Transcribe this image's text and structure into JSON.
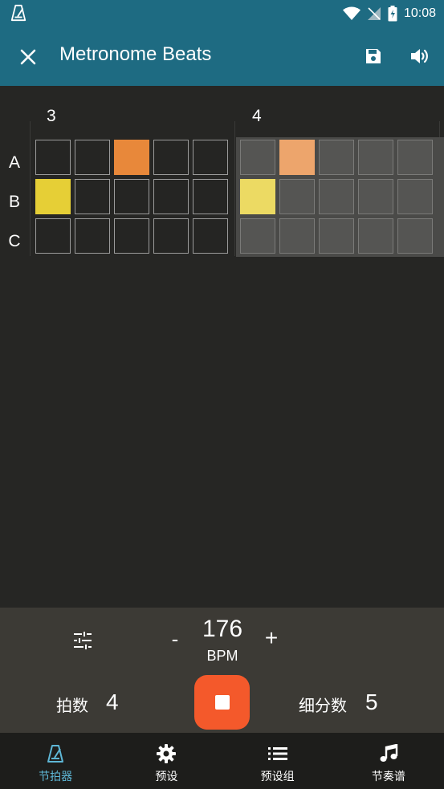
{
  "status_bar": {
    "time": "10:08"
  },
  "app_bar": {
    "title": "Metronome Beats"
  },
  "grid": {
    "bars": [
      {
        "number": "3",
        "active": true
      },
      {
        "number": "4",
        "active": false
      }
    ],
    "rows": [
      "A",
      "B",
      "C"
    ],
    "colors": {
      "orange": "#e8883a",
      "yellow": "#e6cf36",
      "grid_border": "#9a9a9a"
    }
  },
  "controls": {
    "bpm_value": "176",
    "bpm_label": "BPM",
    "minus_label": "-",
    "plus_label": "+",
    "beats_label": "拍数",
    "beats_value": "4",
    "subdivision_label": "细分数",
    "subdivision_value": "5",
    "stop_color": "#f4592b"
  },
  "bottom_nav": {
    "items": [
      {
        "label": "节拍器",
        "icon": "metronome-icon",
        "active": true
      },
      {
        "label": "预设",
        "icon": "gear-icon",
        "active": false
      },
      {
        "label": "预设组",
        "icon": "list-icon",
        "active": false
      },
      {
        "label": "节奏谱",
        "icon": "music-note-icon",
        "active": false
      }
    ],
    "active_color": "#5eb7d6"
  }
}
